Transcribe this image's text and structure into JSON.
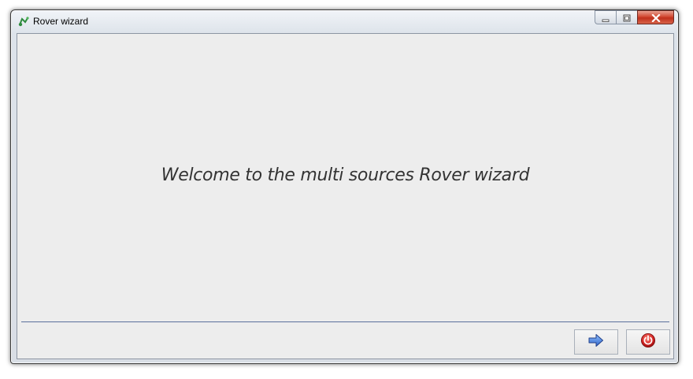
{
  "window": {
    "title": "Rover wizard",
    "app_icon": "rover-app-icon"
  },
  "title_controls": {
    "minimize": "minimize-icon",
    "maximize": "maximize-icon",
    "close": "close-icon"
  },
  "content": {
    "welcome_text": "Welcome to the multi sources Rover wizard"
  },
  "footer": {
    "next_icon": "arrow-right-icon",
    "exit_icon": "power-icon"
  },
  "colors": {
    "next_arrow": "#3f7de0",
    "power_button": "#c8191b",
    "separator": "#5b6f9c"
  }
}
